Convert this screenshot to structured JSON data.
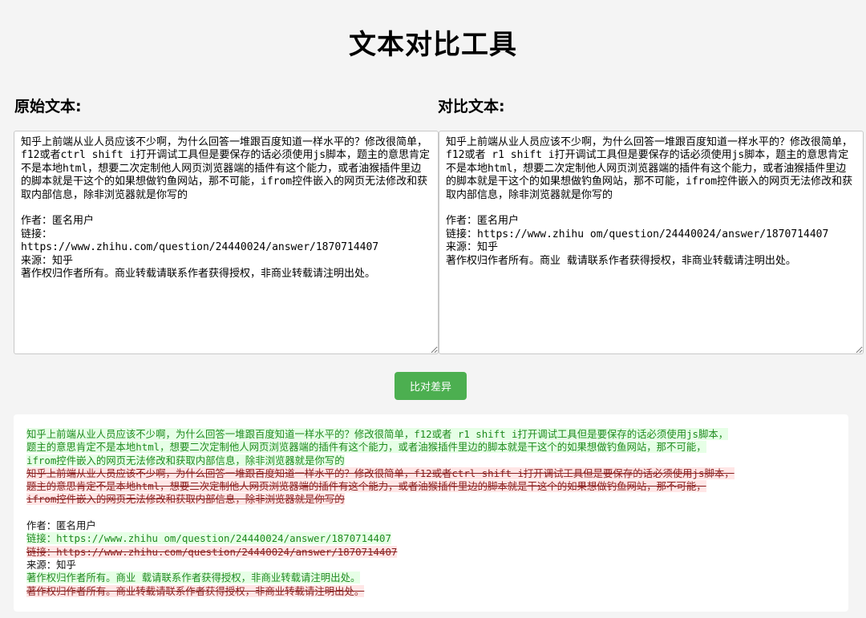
{
  "page": {
    "title": "文本对比工具",
    "original_label": "原始文本:",
    "compare_label": "对比文本:",
    "compare_button": "比对差异"
  },
  "inputs": {
    "original_text": "知乎上前端从业人员应该不少啊，为什么回答一堆跟百度知道一样水平的？修改很简单，f12或者ctrl shift i打开调试工具但是要保存的话必须使用js脚本，题主的意思肯定不是本地html，想要二次定制他人网页浏览器端的插件有这个能力，或者油猴插件里边的脚本就是干这个的如果想做钓鱼网站，那不可能，ifrom控件嵌入的网页无法修改和获取内部信息，除非浏览器就是你写的\n\n作者：匿名用户\n链接：\nhttps://www.zhihu.com/question/24440024/answer/1870714407\n来源：知乎\n著作权归作者所有。商业转载请联系作者获得授权，非商业转载请注明出处。",
    "compare_text": "知乎上前端从业人员应该不少啊，为什么回答一堆跟百度知道一样水平的？修改很简单，f12或者 r1 shift i打开调试工具但是要保存的话必须使用js脚本，题主的意思肯定不是本地html，想要二次定制他人网页浏览器端的插件有这个能力，或者油猴插件里边的脚本就是干这个的如果想做钓鱼网站，那不可能，ifrom控件嵌入的网页无法修改和获取内部信息，除非浏览器就是你写的\n\n作者：匿名用户\n链接：https://www.zhihu om/question/24440024/answer/1870714407\n来源：知乎\n著作权归作者所有。商业 载请联系作者获得授权，非商业转载请注明出处。"
  },
  "diff_result": [
    {
      "type": "added",
      "text": "知乎上前端从业人员应该不少啊，为什么回答一堆跟百度知道一样水平的？修改很简单，f12或者 r1 shift i打开调试工具但是要保存的话必须使用js脚本，\n题主的意思肯定不是本地html，想要二次定制他人网页浏览器端的插件有这个能力，或者油猴插件里边的脚本就是干这个的如果想做钓鱼网站，那不可能，\nifrom控件嵌入的网页无法修改和获取内部信息，除非浏览器就是你写的"
    },
    {
      "type": "removed",
      "text": "知乎上前端从业人员应该不少啊，为什么回答一堆跟百度知道一样水平的？修改很简单，f12或者ctrl shift i打开调试工具但是要保存的话必须使用js脚本，\n题主的意思肯定不是本地html，想要二次定制他人网页浏览器端的插件有这个能力，或者油猴插件里边的脚本就是干这个的如果想做钓鱼网站，那不可能，\nifrom控件嵌入的网页无法修改和获取内部信息，除非浏览器就是你写的"
    },
    {
      "type": "unchanged",
      "text": "\n作者：匿名用户"
    },
    {
      "type": "added",
      "text": "链接：https://www.zhihu om/question/24440024/answer/1870714407"
    },
    {
      "type": "removed",
      "text": "链接：https://www.zhihu.com/question/24440024/answer/1870714407"
    },
    {
      "type": "unchanged",
      "text": "来源：知乎"
    },
    {
      "type": "added",
      "text": "著作权归作者所有。商业 载请联系作者获得授权，非商业转载请注明出处。"
    },
    {
      "type": "removed",
      "text": "著作权归作者所有。商业转载请联系作者获得授权，非商业转载请注明出处。"
    }
  ],
  "colors": {
    "button_bg": "#4caf50",
    "added_bg": "#e6ffe6",
    "added_fg": "#1f8a1f",
    "removed_bg": "#ffe6e6",
    "removed_fg": "#8a1f1f"
  }
}
